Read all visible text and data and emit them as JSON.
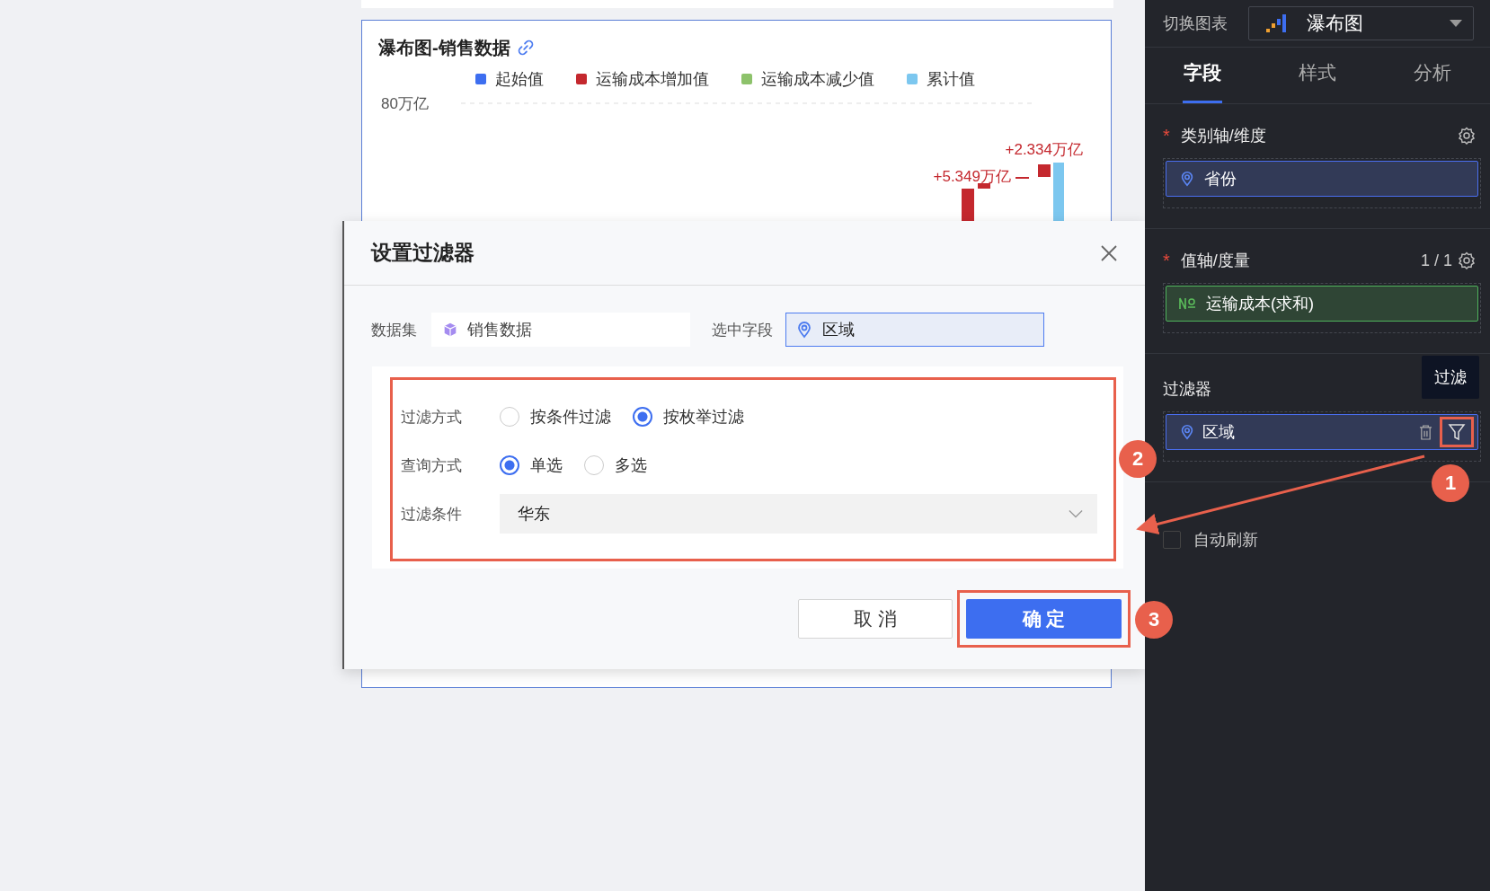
{
  "chart": {
    "title": "瀑布图-销售数据",
    "legend": [
      {
        "label": "起始值",
        "color": "#3d6ef0"
      },
      {
        "label": "运输成本增加值",
        "color": "#c4282e"
      },
      {
        "label": "运输成本减少值",
        "color": "#8dc26b"
      },
      {
        "label": "累计值",
        "color": "#7cc7ef"
      }
    ],
    "y_label": "80万亿",
    "data_labels": [
      "+2.334万亿",
      "+5.349万亿"
    ]
  },
  "dialog": {
    "title": "设置过滤器",
    "dataset_label": "数据集",
    "dataset": "销售数据",
    "field_label": "选中字段",
    "field": "区域",
    "rows": [
      {
        "label": "过滤方式",
        "kind": "radio",
        "options": [
          {
            "label": "按条件过滤",
            "selected": false
          },
          {
            "label": "按枚举过滤",
            "selected": true
          }
        ]
      },
      {
        "label": "查询方式",
        "kind": "radio",
        "options": [
          {
            "label": "单选",
            "selected": true
          },
          {
            "label": "多选",
            "selected": false
          }
        ]
      },
      {
        "label": "过滤条件",
        "kind": "select",
        "value": "华东"
      }
    ],
    "buttons": [
      {
        "label": "取 消",
        "kind": "secondary"
      },
      {
        "label": "确 定",
        "kind": "primary"
      }
    ]
  },
  "panel": {
    "switch_label": "切换图表",
    "chart_type": "瀑布图",
    "tabs": [
      {
        "label": "字段",
        "selected": true
      },
      {
        "label": "样式",
        "selected": false
      },
      {
        "label": "分析",
        "selected": false
      }
    ],
    "sections": [
      {
        "title": "类别轴/维度",
        "marker": "*",
        "field": {
          "label": "省份",
          "kind": "dimension"
        }
      },
      {
        "title": "值轴/度量",
        "marker": "*",
        "count": "1 / 1",
        "field": {
          "label": "运输成本(求和)",
          "kind": "measure"
        }
      }
    ],
    "filter": {
      "title": "过滤器",
      "tooltip": "过滤",
      "field": "区域"
    },
    "auto_refresh": {
      "label": "自动刷新",
      "checked": false
    }
  },
  "annotations": [
    {
      "number": "1"
    },
    {
      "number": "2"
    },
    {
      "number": "3"
    }
  ]
}
